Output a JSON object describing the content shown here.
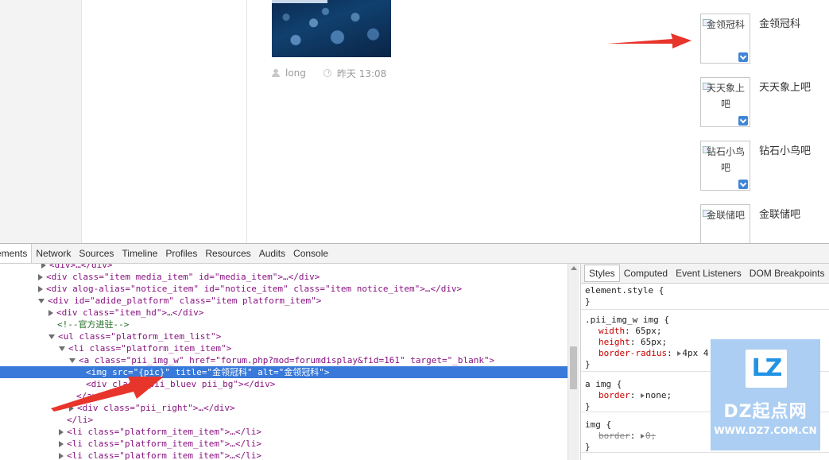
{
  "post": {
    "author": "long",
    "time": "昨天 13:08"
  },
  "forums": [
    {
      "alt": "金领冠科",
      "name": "金领冠科"
    },
    {
      "alt": "天天象上吧",
      "name": "天天象上吧"
    },
    {
      "alt": "钻石小鸟吧",
      "name": "钻石小鸟吧"
    },
    {
      "alt": "金联储吧",
      "name": "金联储吧"
    }
  ],
  "devtools": {
    "tabs": [
      "ements",
      "Network",
      "Sources",
      "Timeline",
      "Profiles",
      "Resources",
      "Audits",
      "Console"
    ],
    "active_tab": "ements",
    "style_tabs": [
      "Styles",
      "Computed",
      "Event Listeners",
      "DOM Breakpoints",
      "P"
    ],
    "active_style_tab": "Styles",
    "dom_lines": [
      "<div>…</div>",
      "<div class=\"item media_item\" id=\"media_item\">…</div>",
      "<div alog-alias=\"notice_item\" id=\"notice_item\" class=\"item notice_item\">…</div>",
      "<div id=\"adide_platform\" class=\"item platform_item\">",
      "<div class=\"item_hd\">…</div>",
      "<!--官方进驻-->",
      "<ul class=\"platform_item_list\">",
      "<li class=\"platform_item_item\">",
      "<a class=\"pii_img_w\" href=\"forum.php?mod=forumdisplay&fid=161\" target=\"_blank\">",
      "<img src=\"{pic}\" title=\"金领冠科\" alt=\"金领冠科\">",
      "<div class=\"pii_bluev pii_bg\"></div>",
      "</a>",
      "<div class=\"pii_right\">…</div>",
      "</li>",
      "<li class=\"platform_item_item\">…</li>",
      "<li class=\"platform_item_item\">…</li>",
      "<li class=\"platform_item_item\">…</li>"
    ],
    "styles": {
      "element_style": "element.style {",
      "close": "}",
      "rule1_selector": ".pii_img_w img {",
      "rule1_props": [
        {
          "name": "width",
          "value": "65px;"
        },
        {
          "name": "height",
          "value": "65px;"
        },
        {
          "name": "border-radius",
          "value": "4px 4"
        }
      ],
      "rule2_selector": "a img {",
      "rule2_props": [
        {
          "name": "border",
          "value": "none;"
        }
      ],
      "rule3_selector": "img {",
      "rule3_props": [
        {
          "name": "border",
          "value": "0;"
        }
      ]
    }
  },
  "watermark": {
    "logo": "LZ",
    "name": "DZ起点网",
    "url": "WWW.DZ7.COM.CN"
  }
}
